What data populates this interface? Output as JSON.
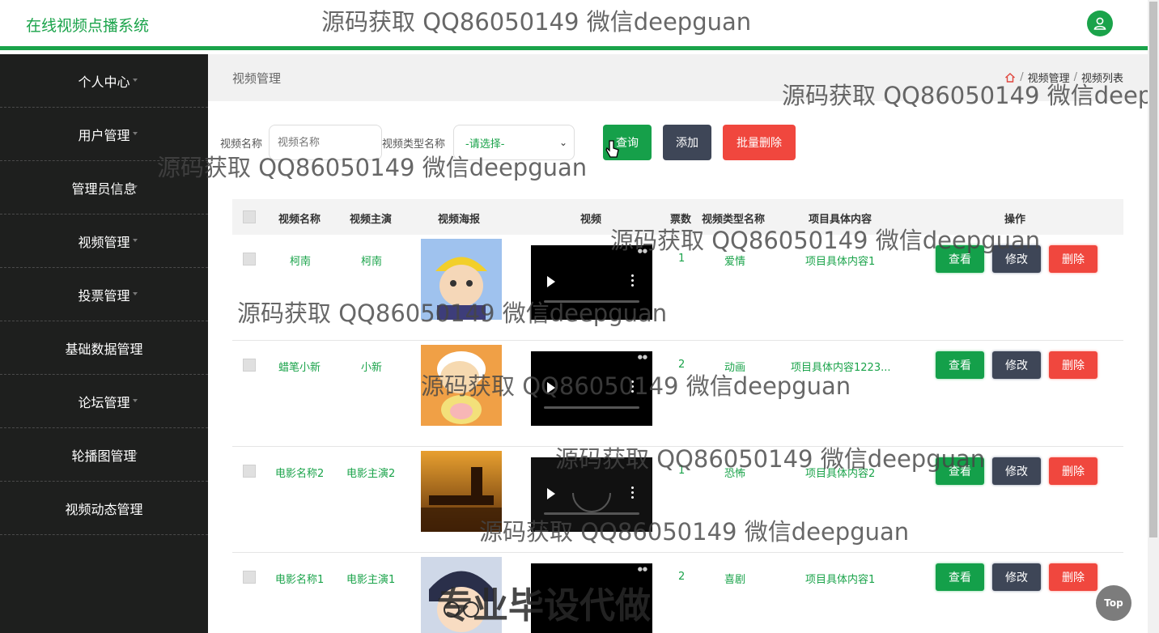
{
  "header": {
    "app_title": "在线视频点播系统"
  },
  "watermark": {
    "text": "源码获取 QQ86050149 微信deepguan",
    "badge": "专业毕设代做"
  },
  "sidebar": {
    "items": [
      {
        "label": "个人中心"
      },
      {
        "label": "用户管理"
      },
      {
        "label": "管理员信息"
      },
      {
        "label": "视频管理"
      },
      {
        "label": "投票管理"
      },
      {
        "label": "基础数据管理"
      },
      {
        "label": "论坛管理"
      },
      {
        "label": "轮播图管理"
      },
      {
        "label": "视频动态管理"
      }
    ]
  },
  "breadcrumb": {
    "page_title": "视频管理",
    "items": [
      "视频管理",
      "视频列表"
    ],
    "separator": "/"
  },
  "search": {
    "name_label": "视频名称",
    "name_placeholder": "视频名称",
    "type_label": "视频类型名称",
    "type_selected": "-请选择-",
    "query_button": "查询",
    "add_button": "添加",
    "batch_delete_button": "批量删除"
  },
  "table": {
    "columns": [
      "视频名称",
      "视频主演",
      "视频海报",
      "视频",
      "票数",
      "视频类型名称",
      "项目具体内容",
      "操作"
    ],
    "actions": {
      "view": "查看",
      "edit": "修改",
      "delete": "删除"
    },
    "rows": [
      {
        "name": "柯南",
        "actor": "柯南",
        "votes": "1",
        "type": "爱情",
        "content": "项目具体内容1"
      },
      {
        "name": "蜡笔小新",
        "actor": "小新",
        "votes": "2",
        "type": "动画",
        "content": "项目具体内容1223..."
      },
      {
        "name": "电影名称2",
        "actor": "电影主演2",
        "votes": "1",
        "type": "恐怖",
        "content": "项目具体内容2"
      },
      {
        "name": "电影名称1",
        "actor": "电影主演1",
        "votes": "2",
        "type": "喜剧",
        "content": "项目具体内容1"
      }
    ]
  },
  "back_to_top": "Top",
  "colors": {
    "accent": "#1aa34a",
    "sidebar_bg": "#1e1f1e",
    "danger": "#f0473e",
    "dark_button": "#3e4657"
  }
}
